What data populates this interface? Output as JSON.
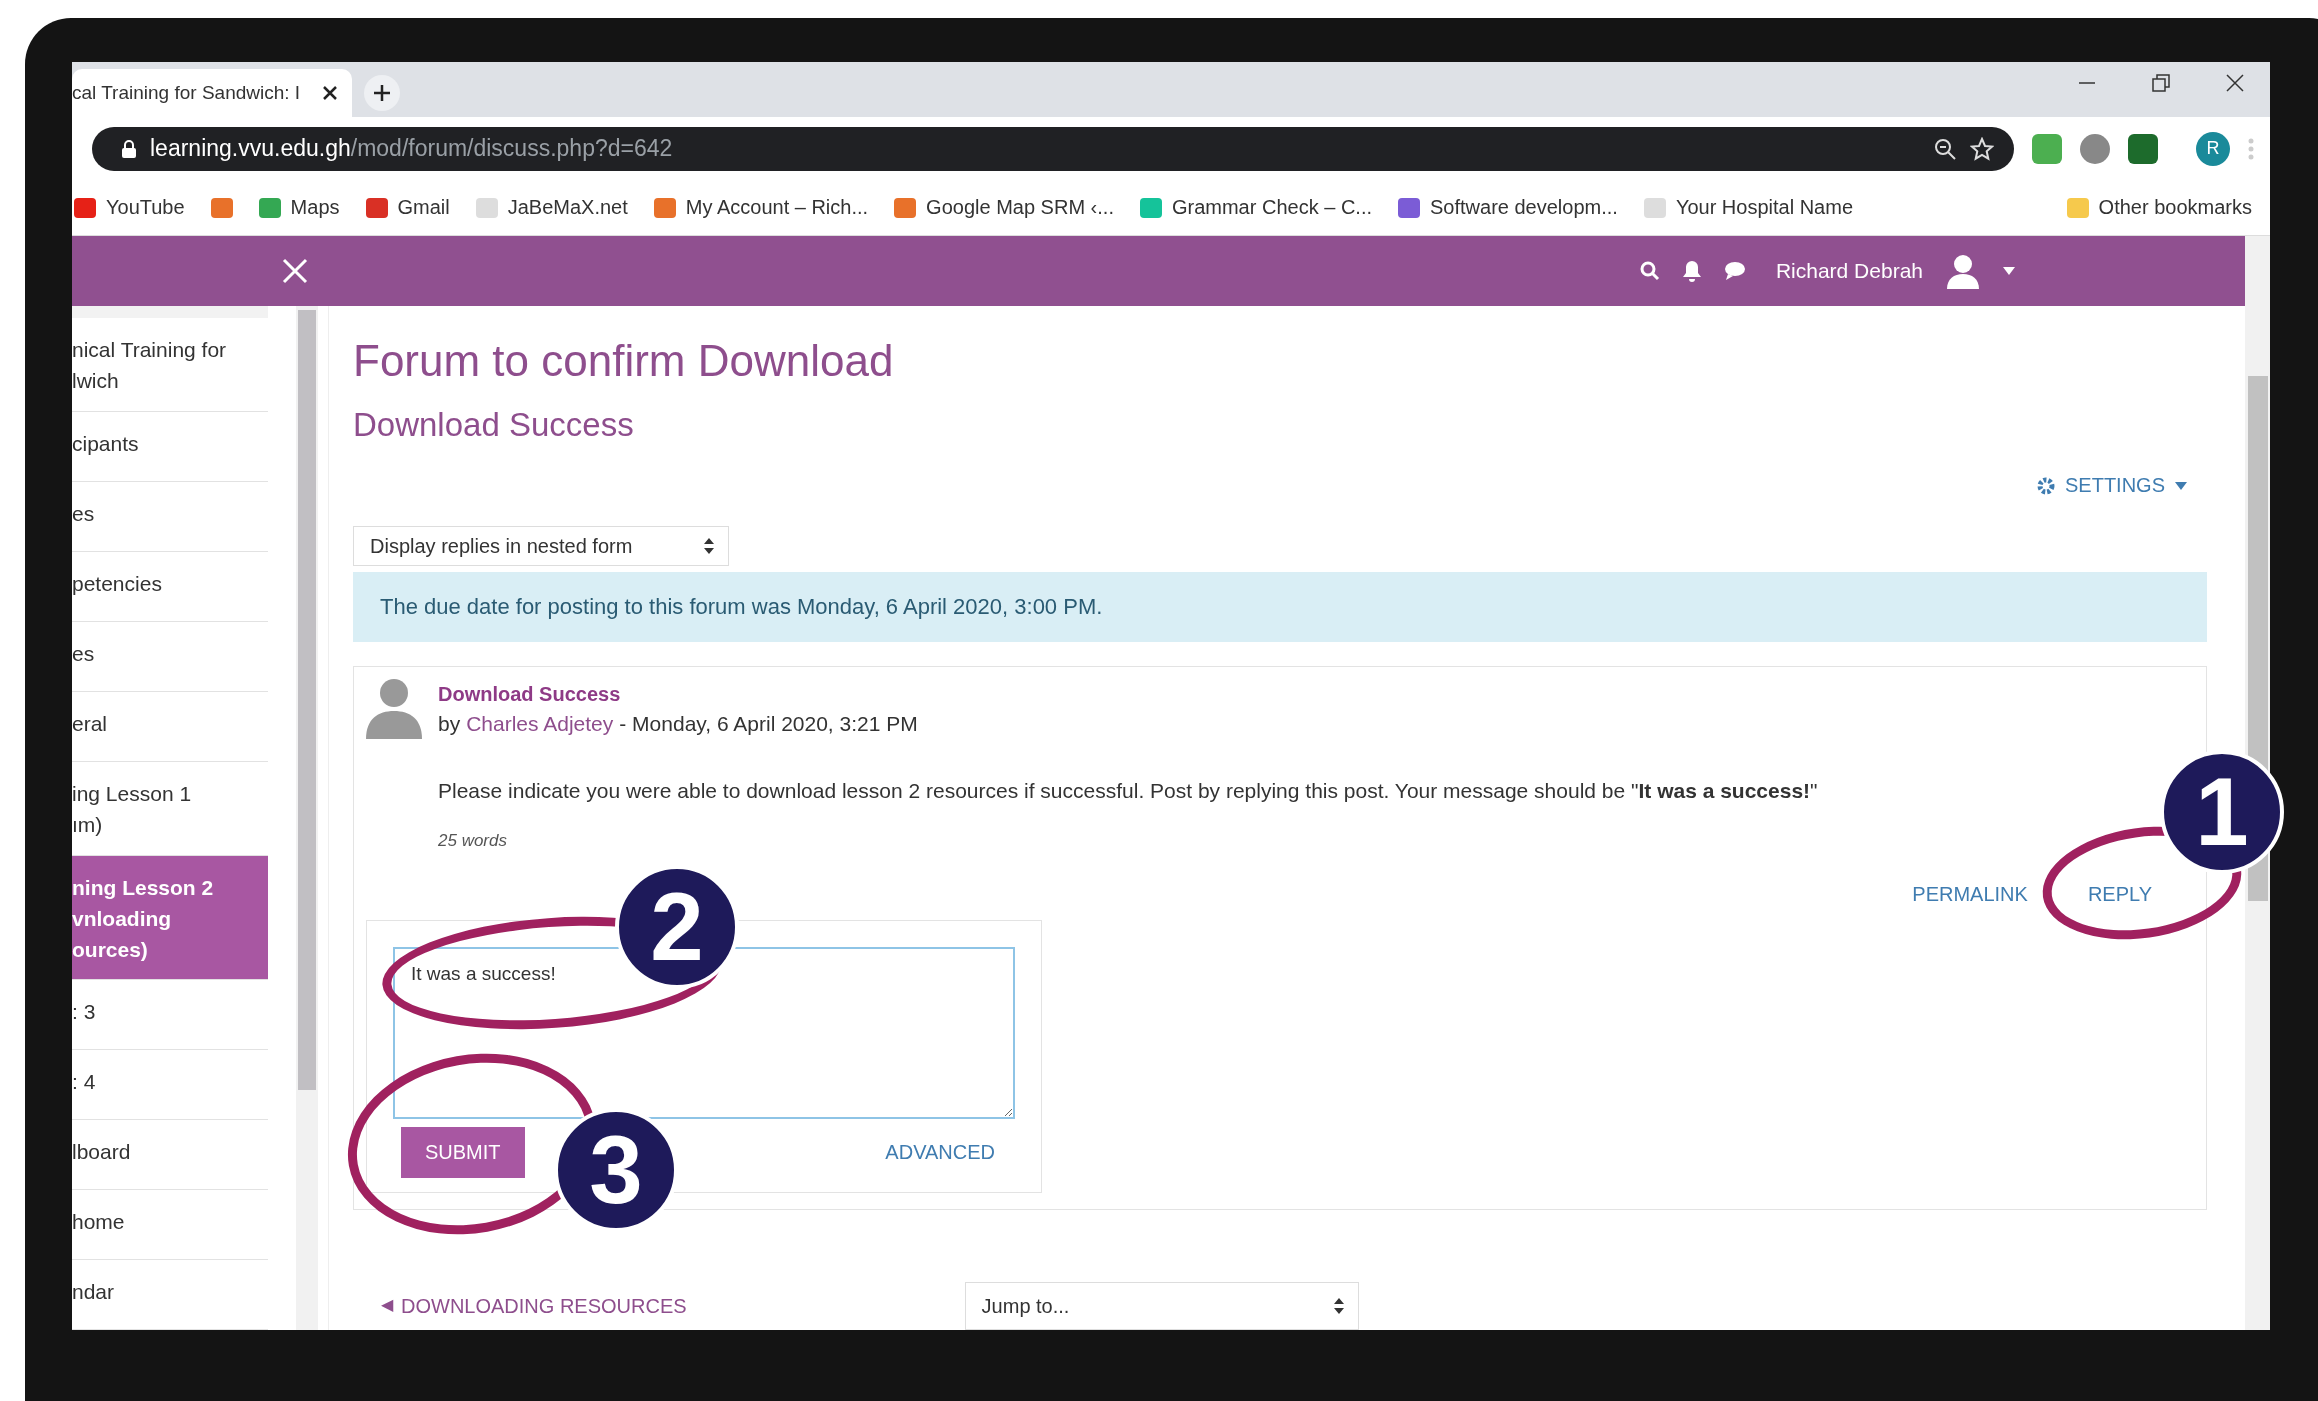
{
  "browser": {
    "tab_title": "cal Training for Sandwich: I",
    "url_host": "learning.vvu.edu.gh",
    "url_path": "/mod/forum/discuss.php?d=642",
    "profile_initial": "R",
    "bookmarks": [
      {
        "label": "YouTube",
        "color": "#e62117"
      },
      {
        "color": "#e8712a"
      },
      {
        "label": "Maps",
        "color": "#34a853"
      },
      {
        "label": "Gmail",
        "color": "#d93025"
      },
      {
        "label": "JaBeMaX.net",
        "color": "#dddddd"
      },
      {
        "label": "My Account – Rich...",
        "color": "#e8712a"
      },
      {
        "label": "Google Map SRM ‹...",
        "color": "#e8712a"
      },
      {
        "label": "Grammar Check – C...",
        "color": "#15c39a"
      },
      {
        "label": "Software developm...",
        "color": "#7b5cd6"
      },
      {
        "label": "Your Hospital Name",
        "color": "#dddddd"
      },
      {
        "label": "Other bookmarks",
        "color": "#f6c94c"
      }
    ]
  },
  "navbar": {
    "user_name": "Richard Debrah"
  },
  "sidebar": {
    "items": [
      {
        "label": "nical Training for\nlwich",
        "selected": false
      },
      {
        "label": "cipants",
        "selected": false
      },
      {
        "label": "es",
        "selected": false
      },
      {
        "label": "petencies",
        "selected": false
      },
      {
        "label": "es",
        "selected": false
      },
      {
        "label": "eral",
        "selected": false
      },
      {
        "label": "ing Lesson 1\nım)",
        "selected": false
      },
      {
        "label": "ning Lesson 2\nvnloading\nources)",
        "selected": true
      },
      {
        "label": ": 3",
        "selected": false
      },
      {
        "label": ": 4",
        "selected": false
      },
      {
        "label": "lboard",
        "selected": false
      },
      {
        "label": "home",
        "selected": false
      },
      {
        "label": "ndar",
        "selected": false
      }
    ]
  },
  "main": {
    "title": "Forum to confirm Download",
    "subtitle": "Download Success",
    "settings_label": "SETTINGS",
    "display_select": "Display replies in nested form",
    "notice": "The due date for posting to this forum was Monday, 6 April 2020, 3:00 PM.",
    "post": {
      "title": "Download Success",
      "by": "by",
      "author": "Charles Adjetey",
      "date": "- Monday, 6 April 2020, 3:21 PM",
      "message": "Please indicate you were able to download lesson 2 resources if successful. Post by replying this post. Your message should be \"**It was a success!**\"",
      "word_count": "25 words",
      "actions": [
        "PERMALINK",
        "REPLY"
      ]
    },
    "reply_form": {
      "value": "It was a success!",
      "submit": "SUBMIT",
      "advanced": "ADVANCED"
    },
    "footer": {
      "prev_icon": "◀",
      "prev_link": "DOWNLOADING RESOURCES",
      "jump_select": "Jump to..."
    }
  },
  "annotations": [
    "1",
    "2",
    "3"
  ]
}
